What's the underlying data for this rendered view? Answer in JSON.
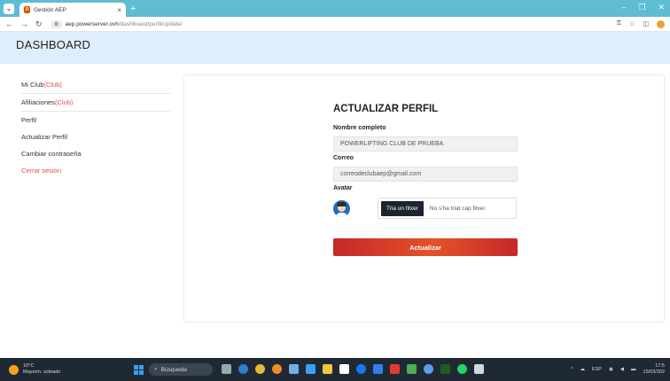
{
  "browser": {
    "tab_title": "Gestión AEP",
    "favicon_label": "0",
    "url_host": "aep.powerserver.ovh",
    "url_path": "/dashboard/perfil/update/"
  },
  "header": {
    "title": "DASHBOARD"
  },
  "sidebar": {
    "items": [
      {
        "label": "Mi Club",
        "badge": "(Club)"
      },
      {
        "label": "Afiliaciones",
        "badge": "(Club)"
      },
      {
        "label": "Perfil"
      },
      {
        "label": "Actualizar Perfil"
      },
      {
        "label": "Cambiar contraseña"
      },
      {
        "label": "Cerrar sesión"
      }
    ]
  },
  "form": {
    "title": "ACTUALIZAR PERFIL",
    "name_label": "Nombre completo",
    "name_value": "POWERLIFTING CLUB DE PRUEBA",
    "email_label": "Correo",
    "email_value": "correodeclubaep@gmail.com",
    "avatar_label": "Avatar",
    "file_button": "Tria un fitxer",
    "file_status": "No s'ha triat cap fitxer",
    "submit_label": "Actualizar"
  },
  "taskbar": {
    "temperature": "10°C",
    "weather": "Mayorm. soleado",
    "search_placeholder": "Búsqueda",
    "lang": "ESP",
    "time": "17:5",
    "date": "15/03/202"
  },
  "colors": {
    "accent_red": "#d9534f",
    "header_bg": "#dfeefc",
    "tab_bg": "#5fbcd3",
    "taskbar_bg": "#1f2933"
  }
}
